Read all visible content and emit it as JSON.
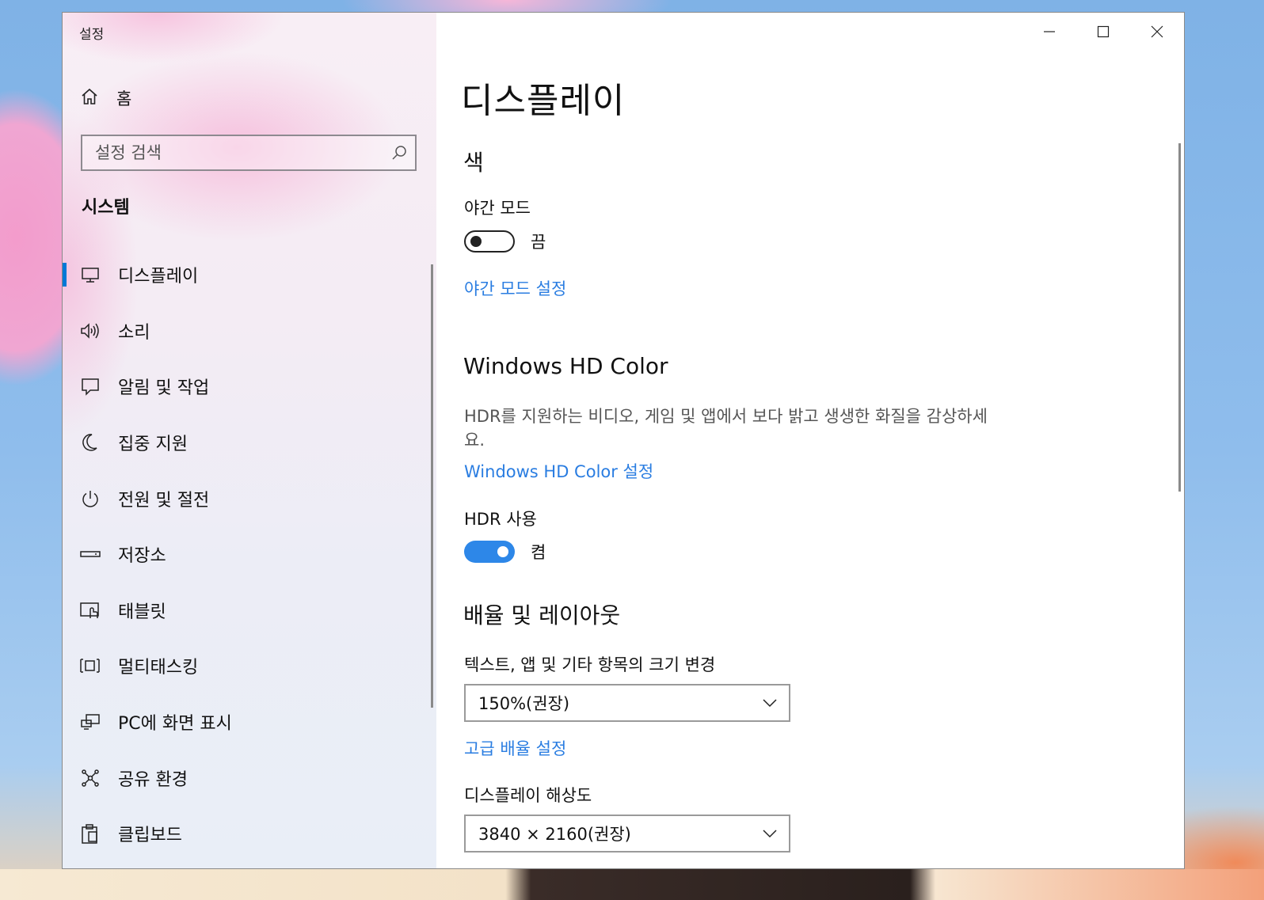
{
  "window": {
    "app_title": "설정"
  },
  "sidebar": {
    "home_label": "홈",
    "search_placeholder": "설정 검색",
    "section_title": "시스템",
    "items": [
      {
        "label": "디스플레이",
        "icon": "monitor-icon"
      },
      {
        "label": "소리",
        "icon": "speaker-icon"
      },
      {
        "label": "알림 및 작업",
        "icon": "notification-icon"
      },
      {
        "label": "집중 지원",
        "icon": "moon-icon"
      },
      {
        "label": "전원 및 절전",
        "icon": "power-icon"
      },
      {
        "label": "저장소",
        "icon": "storage-icon"
      },
      {
        "label": "태블릿",
        "icon": "tablet-icon"
      },
      {
        "label": "멀티태스킹",
        "icon": "multitasking-icon"
      },
      {
        "label": "PC에 화면 표시",
        "icon": "projecting-icon"
      },
      {
        "label": "공유 환경",
        "icon": "share-icon"
      },
      {
        "label": "클립보드",
        "icon": "clipboard-icon"
      }
    ],
    "selected_index": 0
  },
  "main": {
    "page_title": "디스플레이",
    "color_section": {
      "heading": "색",
      "night_mode_label": "야간 모드",
      "night_mode_state": "끔",
      "night_mode_on": false,
      "night_mode_link": "야간 모드 설정"
    },
    "hd_color_section": {
      "heading": "Windows HD Color",
      "description": "HDR를 지원하는 비디오, 게임 및 앱에서 보다 밝고 생생한 화질을 감상하세요.",
      "link": "Windows HD Color 설정",
      "hdr_label": "HDR 사용",
      "hdr_state": "켬",
      "hdr_on": true
    },
    "scale_section": {
      "heading": "배율 및 레이아웃",
      "scale_label": "텍스트, 앱 및 기타 항목의 크기 변경",
      "scale_value": "150%(권장)",
      "advanced_link": "고급 배율 설정",
      "resolution_label": "디스플레이 해상도",
      "resolution_value": "3840 × 2160(권장)"
    }
  },
  "colors": {
    "accent": "#0078d7",
    "link": "#2a7de1",
    "toggle_on": "#2d87e8"
  }
}
